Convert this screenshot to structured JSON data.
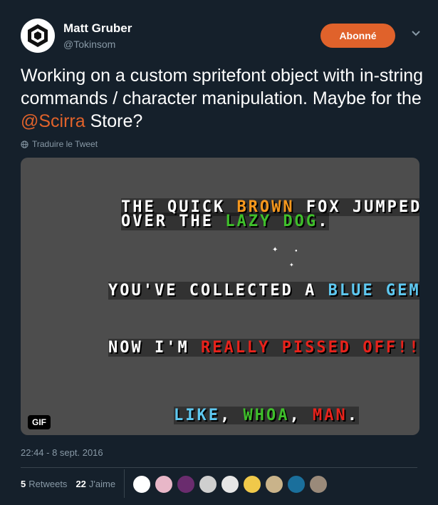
{
  "user": {
    "name": "Matt Gruber",
    "handle": "@Tokinsom",
    "follow_label": "Abonné"
  },
  "tweet": {
    "text_before": "Working on a custom spritefont object with in-string commands / character manipulation. Maybe for the ",
    "mention": "@Scirra",
    "text_after": " Store?",
    "translate_label": "Traduire le Tweet",
    "timestamp": "22:44 - 8 sept. 2016"
  },
  "media": {
    "badge": "GIF",
    "line1": {
      "p1": "THE QUICK ",
      "p2": "BROWN",
      "p3": " FOX JUMPED"
    },
    "line2": {
      "p1": "OVER THE ",
      "p2": "LAZY",
      "p3": " ",
      "p4": "DOG",
      "p5": "."
    },
    "line3": {
      "p1": "YOU'VE COLLECTED A ",
      "p2": "BLUE",
      "p3": " ",
      "p4": "GEM",
      "p5": "!"
    },
    "line4": {
      "p1": "NOW I'M ",
      "p2": "REALLY",
      "p3": " ",
      "p4": "PISSED",
      "p5": " OFF!!!"
    },
    "line5": {
      "p1": "LIKE",
      "p2": ", ",
      "p3": "WHOA",
      "p4": ", ",
      "p5": "MAN",
      "p6": "."
    }
  },
  "stats": {
    "retweets_count": "5",
    "retweets_label": "Retweets",
    "likes_count": "22",
    "likes_label": "J'aime"
  },
  "colors": {
    "background": "#15202b",
    "accent": "#e0622b",
    "muted": "#8899a6",
    "brown": "#f7981d",
    "green": "#3fbf2b",
    "blue": "#5ec8f0",
    "red": "#e8221b",
    "yellow": "#f2e94e",
    "pink": "#e85fa0"
  },
  "likers": [
    {
      "icon": "liker-avatar-1",
      "color": "#ffffff"
    },
    {
      "icon": "liker-avatar-2",
      "color": "#e8b7c8"
    },
    {
      "icon": "liker-avatar-3",
      "color": "#6a2c6e"
    },
    {
      "icon": "liker-avatar-4",
      "color": "#cfcfcf"
    },
    {
      "icon": "liker-avatar-5",
      "color": "#e6e6e6"
    },
    {
      "icon": "liker-avatar-6",
      "color": "#f0c94a"
    },
    {
      "icon": "liker-avatar-7",
      "color": "#c9b38a"
    },
    {
      "icon": "liker-avatar-8",
      "color": "#1a6f9c"
    },
    {
      "icon": "liker-avatar-9",
      "color": "#9a8a7a"
    }
  ]
}
